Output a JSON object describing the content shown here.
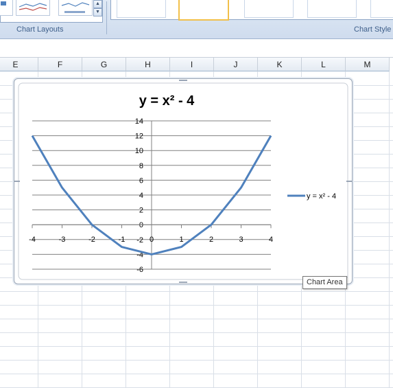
{
  "ribbon": {
    "chart_layouts_label": "Chart Layouts",
    "chart_styles_label": "Chart Style"
  },
  "columns": [
    "E",
    "F",
    "G",
    "H",
    "I",
    "J",
    "K",
    "L",
    "M"
  ],
  "chart": {
    "tooltip": "Chart Area"
  },
  "chart_data": {
    "type": "line",
    "title": "y = x² - 4",
    "x": [
      -4,
      -3,
      -2,
      -1,
      0,
      1,
      2,
      3,
      4
    ],
    "series": [
      {
        "name": "y = x² - 4",
        "values": [
          12,
          5,
          0,
          -3,
          -4,
          -3,
          0,
          5,
          12
        ],
        "color": "#4f81bd"
      }
    ],
    "x_tick_labels": [
      "-4",
      "-3",
      "-2",
      "-1",
      "0",
      "1",
      "2",
      "3",
      "4"
    ],
    "y_tick_labels": [
      "14",
      "12",
      "10",
      "8",
      "6",
      "4",
      "2",
      "0",
      "-2",
      "-4",
      "-6"
    ],
    "xlim": [
      -4,
      4
    ],
    "ylim": [
      -6,
      14
    ],
    "grid": "horizontal major",
    "legend_position": "right"
  }
}
